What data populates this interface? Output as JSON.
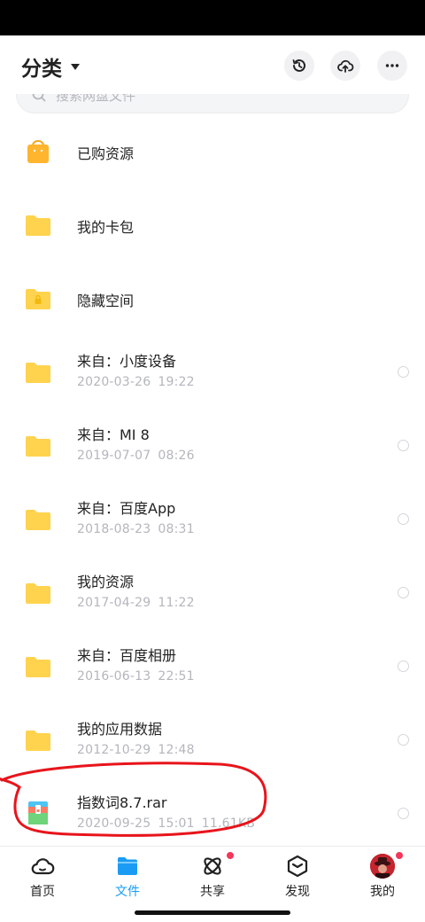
{
  "header": {
    "title": "分类",
    "history_icon": "history-icon",
    "cloud_icon": "cloud-upload-icon",
    "more_icon": "more-icon"
  },
  "search": {
    "placeholder": "搜索网盘文件"
  },
  "items": [
    {
      "name": "已购资源",
      "icon": "shopping-bag-icon",
      "date": "",
      "time": "",
      "size": ""
    },
    {
      "name": "我的卡包",
      "icon": "folder-icon",
      "date": "",
      "time": "",
      "size": ""
    },
    {
      "name": "隐藏空间",
      "icon": "locked-folder-icon",
      "date": "",
      "time": "",
      "size": ""
    },
    {
      "name": "来自：小度设备",
      "icon": "folder-icon",
      "date": "2020-03-26",
      "time": "19:22",
      "size": ""
    },
    {
      "name": "来自：MI 8",
      "icon": "folder-icon",
      "date": "2019-07-07",
      "time": "08:26",
      "size": ""
    },
    {
      "name": "来自：百度App",
      "icon": "folder-icon",
      "date": "2018-08-23",
      "time": "08:31",
      "size": ""
    },
    {
      "name": "我的资源",
      "icon": "folder-icon",
      "date": "2017-04-29",
      "time": "11:22",
      "size": ""
    },
    {
      "name": "来自：百度相册",
      "icon": "folder-icon",
      "date": "2016-06-13",
      "time": "22:51",
      "size": ""
    },
    {
      "name": "我的应用数据",
      "icon": "folder-icon",
      "date": "2012-10-29",
      "time": "12:48",
      "size": ""
    },
    {
      "name": "指数词8.7.rar",
      "icon": "archive-icon",
      "date": "2020-09-25",
      "time": "15:01",
      "size": "11.61KB"
    }
  ],
  "tabs": [
    {
      "label": "首页",
      "icon": "home-cloud-icon",
      "active": false
    },
    {
      "label": "文件",
      "icon": "file-folder-icon",
      "active": true
    },
    {
      "label": "共享",
      "icon": "share-atom-icon",
      "active": false
    },
    {
      "label": "发现",
      "icon": "discover-cube-icon",
      "active": false
    },
    {
      "label": "我的",
      "icon": "avatar",
      "active": false
    }
  ],
  "colors": {
    "folder": "#ffd34d",
    "accent": "#1a9cf4",
    "badge": "#f4375a",
    "annotation": "#e8141b"
  }
}
